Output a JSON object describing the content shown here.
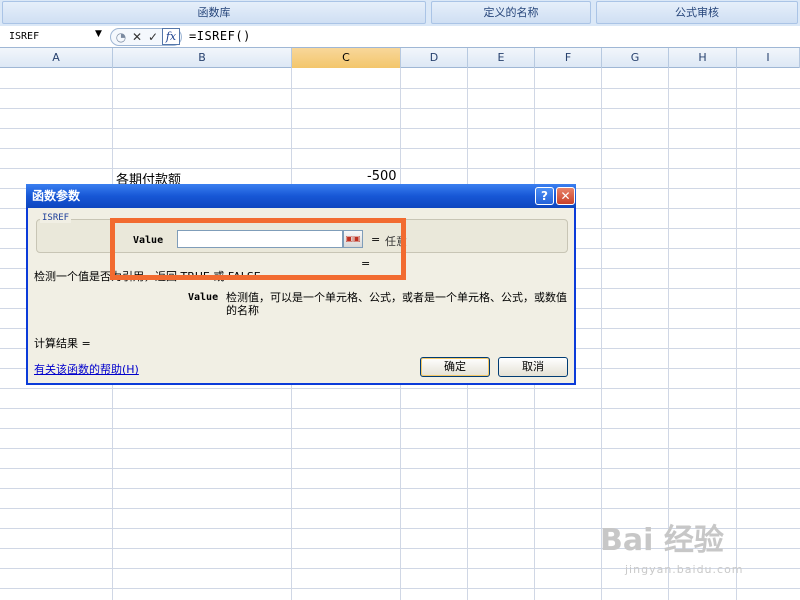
{
  "ribbon": {
    "groups": [
      "函数库",
      "定义的名称",
      "公式审核"
    ]
  },
  "formula_bar": {
    "name_box": "ISREF",
    "cancel_glyph": "✕",
    "enter_glyph": "✓",
    "fx_label": "fx",
    "formula": "=ISREF()"
  },
  "columns": [
    "A",
    "B",
    "C",
    "D",
    "E",
    "F",
    "G",
    "H",
    "I"
  ],
  "selected_column": "C",
  "cells": {
    "B_label": "各期付款额",
    "C_value": "-500"
  },
  "dialog": {
    "title": "函数参数",
    "help_glyph": "?",
    "close_glyph": "✕",
    "function_name": "ISREF",
    "arg_label": "Value",
    "arg_value": "",
    "arg_equals": "=",
    "arg_result": "任意",
    "result_equals": "=",
    "description": "检测一个值是否为引用，返回 TRUE 或 FALSE",
    "param_name": "Value",
    "param_description": "检测值，可以是一个单元格、公式，或者是一个单元格、公式，或数值的名称",
    "calc_result_label": "计算结果 =",
    "help_link": "有关该函数的帮助(H)",
    "ok_label": "确定",
    "cancel_label": "取消"
  },
  "watermark": {
    "main": "Bai 经验",
    "sub": "jingyan.baidu.com"
  },
  "colors": {
    "dialog_title": "#1757d6",
    "highlight": "#f26b30",
    "selected_col": "#f3c66b"
  }
}
